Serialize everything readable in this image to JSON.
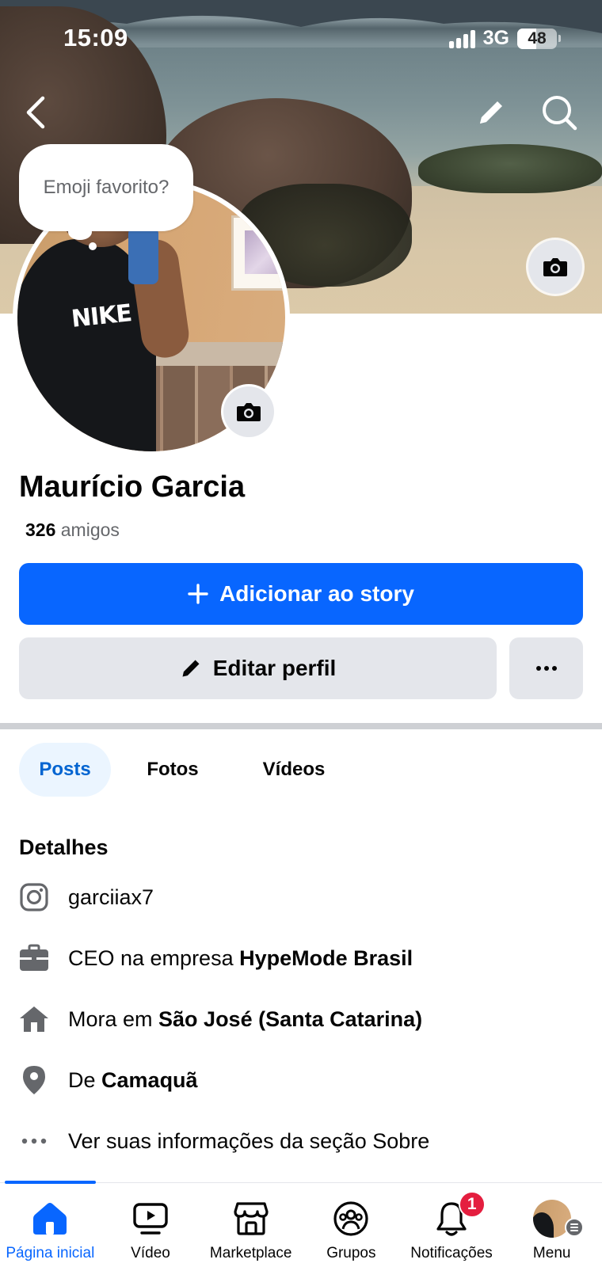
{
  "status": {
    "time": "15:09",
    "network": "3G",
    "battery": "48",
    "battery_level": 0.48
  },
  "cover": {
    "back_icon": "chevron-left-icon",
    "edit_icon": "pencil-icon",
    "search_icon": "search-icon",
    "camera_icon": "camera-icon"
  },
  "profile": {
    "emoji_prompt": "Emoji favorito?",
    "shirt_text": "NIKE",
    "name": "Maurício Garcia",
    "friends_count": "326",
    "friends_label": "amigos"
  },
  "actions": {
    "add_story": "Adicionar ao story",
    "edit_profile": "Editar perfil",
    "more": "···"
  },
  "tabs": [
    {
      "label": "Posts",
      "active": true
    },
    {
      "label": "Fotos",
      "active": false
    },
    {
      "label": "Vídeos",
      "active": false
    }
  ],
  "details": {
    "title": "Detalhes",
    "instagram": {
      "icon": "instagram-icon",
      "text": "garciiax7"
    },
    "work": {
      "icon": "briefcase-icon",
      "prefix": "CEO na empresa ",
      "bold": "HypeMode Brasil"
    },
    "lives": {
      "icon": "home-icon",
      "prefix": "Mora em ",
      "bold": "São José (Santa Catarina)"
    },
    "from": {
      "icon": "location-pin-icon",
      "prefix": "De ",
      "bold": "Camaquã"
    },
    "about": {
      "icon": "more-dots-icon",
      "text": "Ver suas informações da seção Sobre"
    }
  },
  "nav": [
    {
      "label": "Página inicial",
      "icon": "home-icon",
      "active": true
    },
    {
      "label": "Vídeo",
      "icon": "video-icon",
      "active": false
    },
    {
      "label": "Marketplace",
      "icon": "marketplace-icon",
      "active": false
    },
    {
      "label": "Grupos",
      "icon": "groups-icon",
      "active": false
    },
    {
      "label": "Notificações",
      "icon": "bell-icon",
      "active": false,
      "badge": "1"
    },
    {
      "label": "Menu",
      "icon": "profile-avatar",
      "active": false
    }
  ],
  "colors": {
    "primary": "#0866ff",
    "secondary_button": "#e4e6eb",
    "active_tab_bg": "#ebf5ff",
    "active_tab_text": "#0064d1",
    "badge": "#e41e3f"
  }
}
